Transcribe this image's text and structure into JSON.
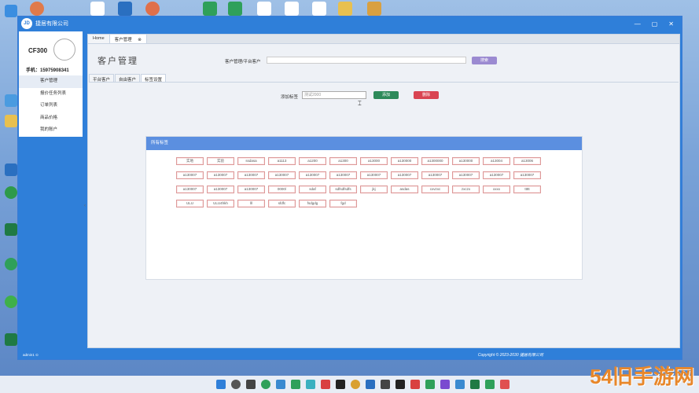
{
  "window": {
    "title": "捷居有限公司",
    "controls": [
      "—",
      "▢",
      "✕"
    ]
  },
  "sidebar": {
    "user_name": "CF300",
    "phone": "手机：15975908341",
    "items": [
      {
        "label": "客户管理"
      },
      {
        "label": "报价任务列表"
      },
      {
        "label": "订单列表"
      },
      {
        "label": "商品价格"
      },
      {
        "label": "我的账户"
      }
    ],
    "collapse_glyph": "‹"
  },
  "tabs": [
    {
      "label": "Home"
    },
    {
      "label": "客户管理",
      "close": "⊗"
    }
  ],
  "page": {
    "title": "客户管理",
    "search_label": "客户管理/平台客户",
    "search_button": "搜索",
    "subtabs": [
      "平台客户",
      "自由客户",
      "标签设置"
    ],
    "add_label": "添加标签",
    "add_placeholder": "测试2000",
    "add_button": "添加",
    "delete_button": "删除",
    "tags_header": "所有标签",
    "tags": [
      "实地",
      "实验",
      "ssdasa",
      "a1113",
      "a1200",
      "a1300",
      "a13000",
      "a130000",
      "a1300000",
      "a130000",
      "a13004",
      "a13006",
      "a130007",
      "a130007",
      "a130007",
      "a130007",
      "a130007",
      "a130007",
      "a130007",
      "a130007",
      "a130007",
      "a130007",
      "a130007",
      "a130007",
      "a130007",
      "a130007",
      "a130007",
      "0000/",
      "sdaf",
      "sdfsdfsdfs",
      "jkj",
      "asdas",
      "cxvzxc",
      "zxczx",
      "xxxx",
      "ttttt",
      "ULU",
      "ULU4hkh",
      "lll",
      "sfdfc",
      "fsdgdg",
      "fgd"
    ]
  },
  "statusbar": {
    "left": "admin1  ⊙",
    "copyright": "Copyright © 2023-2030 捷居有限公司"
  },
  "watermark": "54旧手游网"
}
